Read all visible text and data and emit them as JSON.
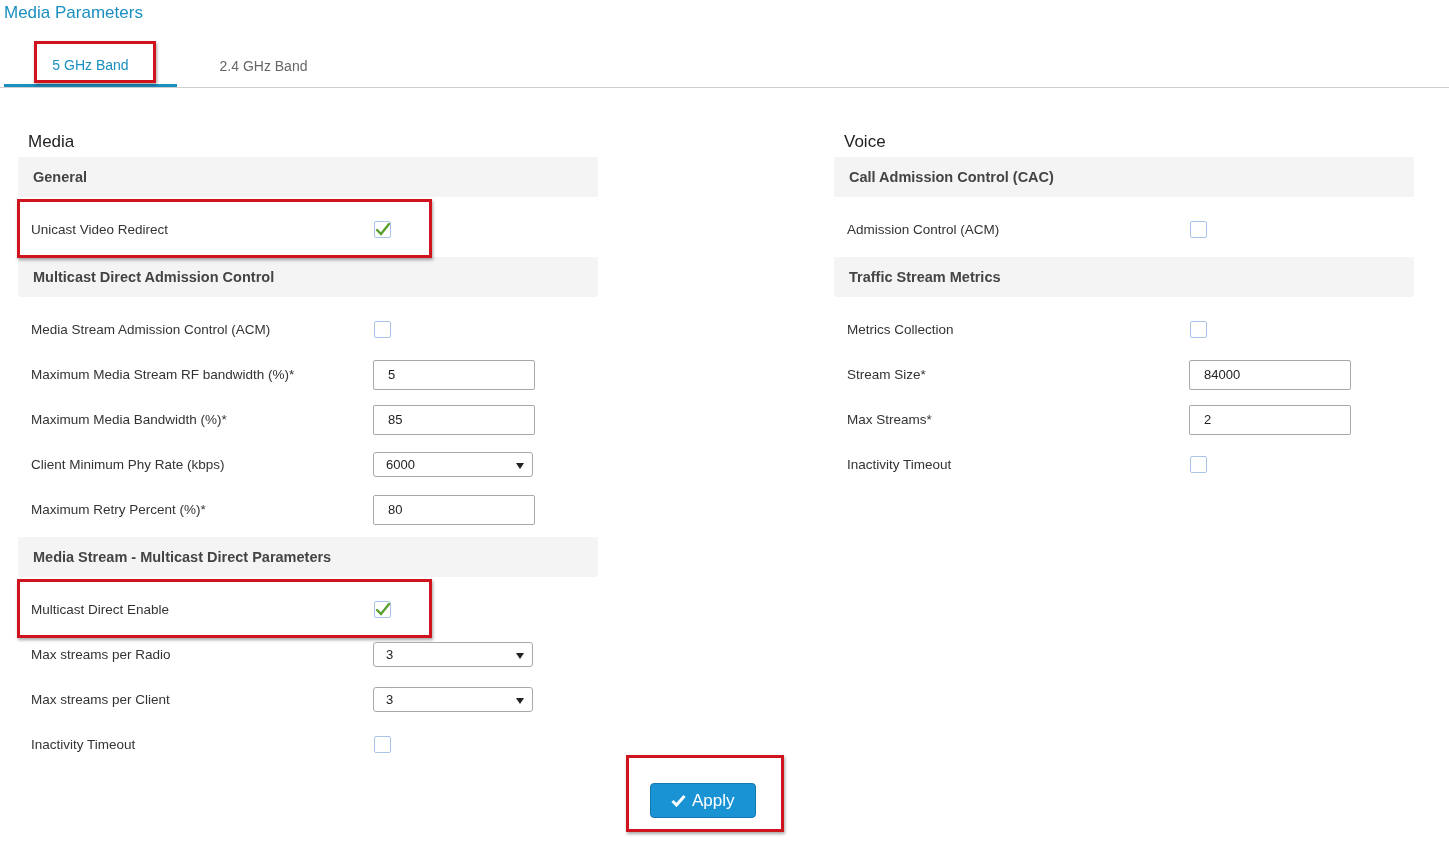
{
  "page_title": "Media Parameters",
  "tabs": [
    {
      "label": "5 GHz Band",
      "selected": true,
      "highlighted": true
    },
    {
      "label": "2.4 GHz Band",
      "selected": false,
      "highlighted": false
    }
  ],
  "columns": [
    {
      "title": "Media",
      "sections": [
        {
          "heading": "General",
          "rows": [
            {
              "kind": "checkbox",
              "label": "Unicast Video Redirect",
              "checked": true,
              "highlighted": true
            }
          ]
        },
        {
          "heading": "Multicast Direct Admission Control",
          "rows": [
            {
              "kind": "checkbox",
              "label": "Media Stream Admission Control (ACM)",
              "checked": false,
              "highlighted": false
            },
            {
              "kind": "input",
              "label": "Maximum Media Stream RF bandwidth (%)*",
              "value": "5",
              "highlighted": false
            },
            {
              "kind": "input",
              "label": "Maximum Media Bandwidth (%)*",
              "value": "85",
              "highlighted": false
            },
            {
              "kind": "select",
              "label": "Client Minimum Phy Rate (kbps)",
              "value": "6000",
              "highlighted": false
            },
            {
              "kind": "input",
              "label": "Maximum Retry Percent (%)*",
              "value": "80",
              "highlighted": false
            }
          ]
        },
        {
          "heading": "Media Stream - Multicast Direct Parameters",
          "rows": [
            {
              "kind": "checkbox",
              "label": "Multicast Direct Enable",
              "checked": true,
              "highlighted": true
            },
            {
              "kind": "select",
              "label": "Max streams per Radio",
              "value": "3",
              "highlighted": false
            },
            {
              "kind": "select",
              "label": "Max streams per Client",
              "value": "3",
              "highlighted": false
            },
            {
              "kind": "checkbox",
              "label": "Inactivity Timeout",
              "checked": false,
              "highlighted": false
            }
          ]
        }
      ]
    },
    {
      "title": "Voice",
      "sections": [
        {
          "heading": "Call Admission Control (CAC)",
          "rows": [
            {
              "kind": "checkbox",
              "label": "Admission Control (ACM)",
              "checked": false,
              "highlighted": false
            }
          ]
        },
        {
          "heading": "Traffic Stream Metrics",
          "rows": [
            {
              "kind": "checkbox",
              "label": "Metrics Collection",
              "checked": false,
              "highlighted": false
            },
            {
              "kind": "input",
              "label": "Stream Size*",
              "value": "84000",
              "highlighted": false
            },
            {
              "kind": "input",
              "label": "Max Streams*",
              "value": "2",
              "highlighted": false
            },
            {
              "kind": "checkbox",
              "label": "Inactivity Timeout",
              "checked": false,
              "highlighted": false
            }
          ]
        }
      ]
    }
  ],
  "apply_button": {
    "label": "Apply",
    "highlighted": true
  }
}
